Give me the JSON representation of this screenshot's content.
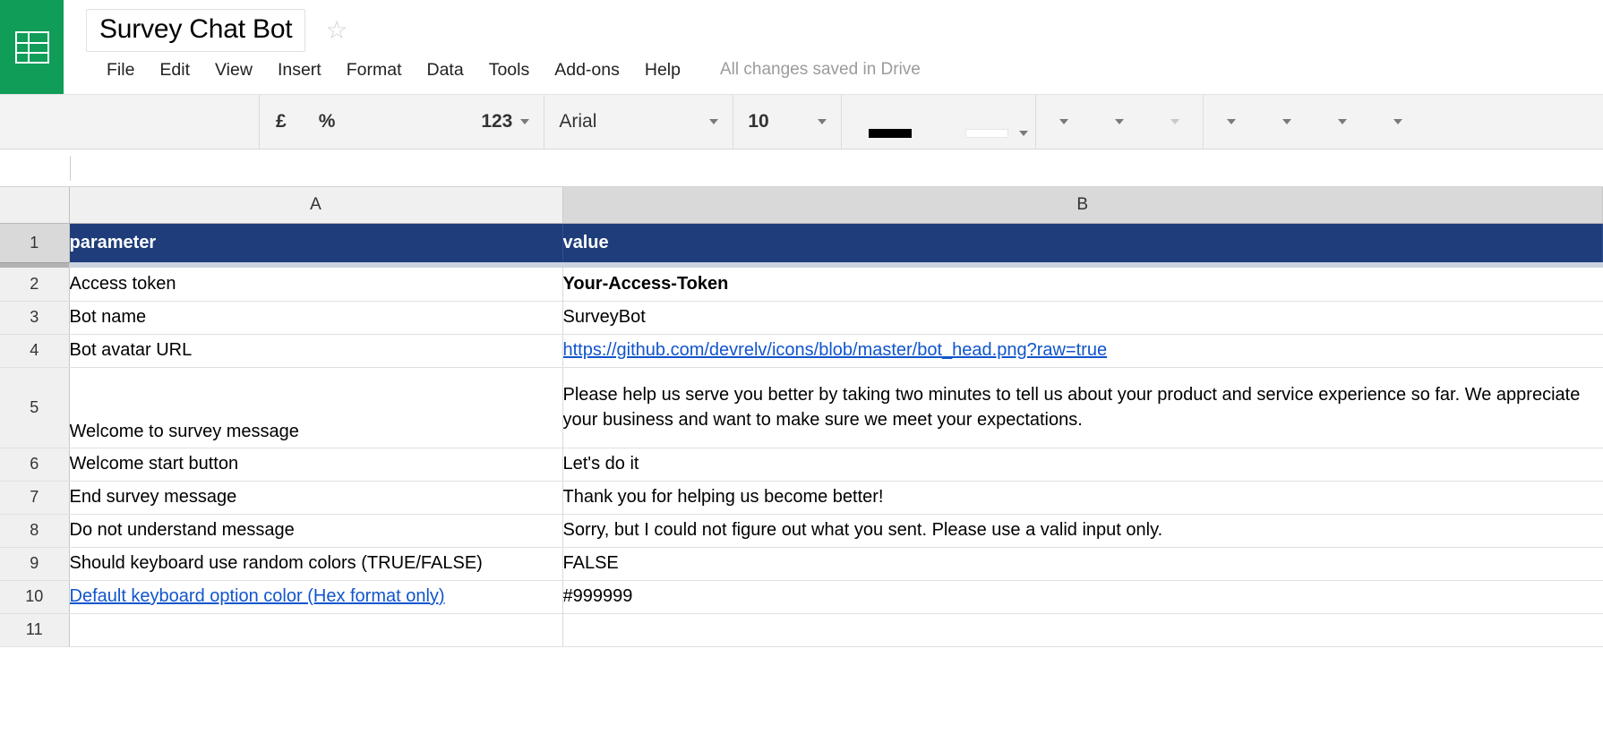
{
  "app": {
    "logo_icon": "sheets-grid-icon",
    "title": "Survey Chat Bot",
    "star_icon": "star-outline-icon",
    "save_status": "All changes saved in Drive"
  },
  "menu": {
    "items": [
      {
        "label": "File"
      },
      {
        "label": "Edit"
      },
      {
        "label": "View"
      },
      {
        "label": "Insert"
      },
      {
        "label": "Format"
      },
      {
        "label": "Data"
      },
      {
        "label": "Tools"
      },
      {
        "label": "Add-ons"
      },
      {
        "label": "Help"
      }
    ]
  },
  "toolbar": {
    "currency_label": "£",
    "percent_label": "%",
    "number_format_label": "123",
    "font_family_value": "Arial",
    "font_size_value": "10",
    "text_color_swatch": "#000000",
    "fill_color_swatch": "#ffffff",
    "caret_icon": "chevron-down-icon"
  },
  "grid": {
    "columns": [
      {
        "label": "A"
      },
      {
        "label": "B"
      }
    ],
    "rows": [
      {
        "num": "1",
        "style": "header",
        "a": "parameter",
        "b": "value"
      },
      {
        "num": "2",
        "style": "normal",
        "a": "Access token",
        "b": "Your-Access-Token",
        "b_bold": true
      },
      {
        "num": "3",
        "style": "normal",
        "a": "Bot name",
        "b": "SurveyBot"
      },
      {
        "num": "4",
        "style": "normal",
        "a": "Bot avatar URL",
        "b": "https://github.com/devrelv/icons/blob/master/bot_head.png?raw=true",
        "b_link": true
      },
      {
        "num": "5",
        "style": "tall",
        "a": "Welcome to survey message",
        "b": "Please help us serve you better by taking two minutes to tell us about your product and service experience so far. We appreciate your business and want to make sure we meet your expectations."
      },
      {
        "num": "6",
        "style": "normal",
        "a": "Welcome start button",
        "b": "Let's do it"
      },
      {
        "num": "7",
        "style": "normal",
        "a": "End survey message",
        "b": "Thank you for helping us become better!"
      },
      {
        "num": "8",
        "style": "normal",
        "a": "Do not understand message",
        "b": "Sorry, but I could not figure out what you sent. Please use a valid input only."
      },
      {
        "num": "9",
        "style": "normal",
        "a": "Should keyboard use random colors (TRUE/FALSE)",
        "b": "FALSE"
      },
      {
        "num": "10",
        "style": "normal",
        "a": "Default keyboard option color (Hex format only)",
        "a_link": true,
        "b": "#999999"
      },
      {
        "num": "11",
        "style": "normal",
        "a": "",
        "b": ""
      }
    ]
  },
  "colors": {
    "brand_green": "#0F9D58",
    "header_navy": "#1f3d7a",
    "link_blue": "#1155cc"
  }
}
